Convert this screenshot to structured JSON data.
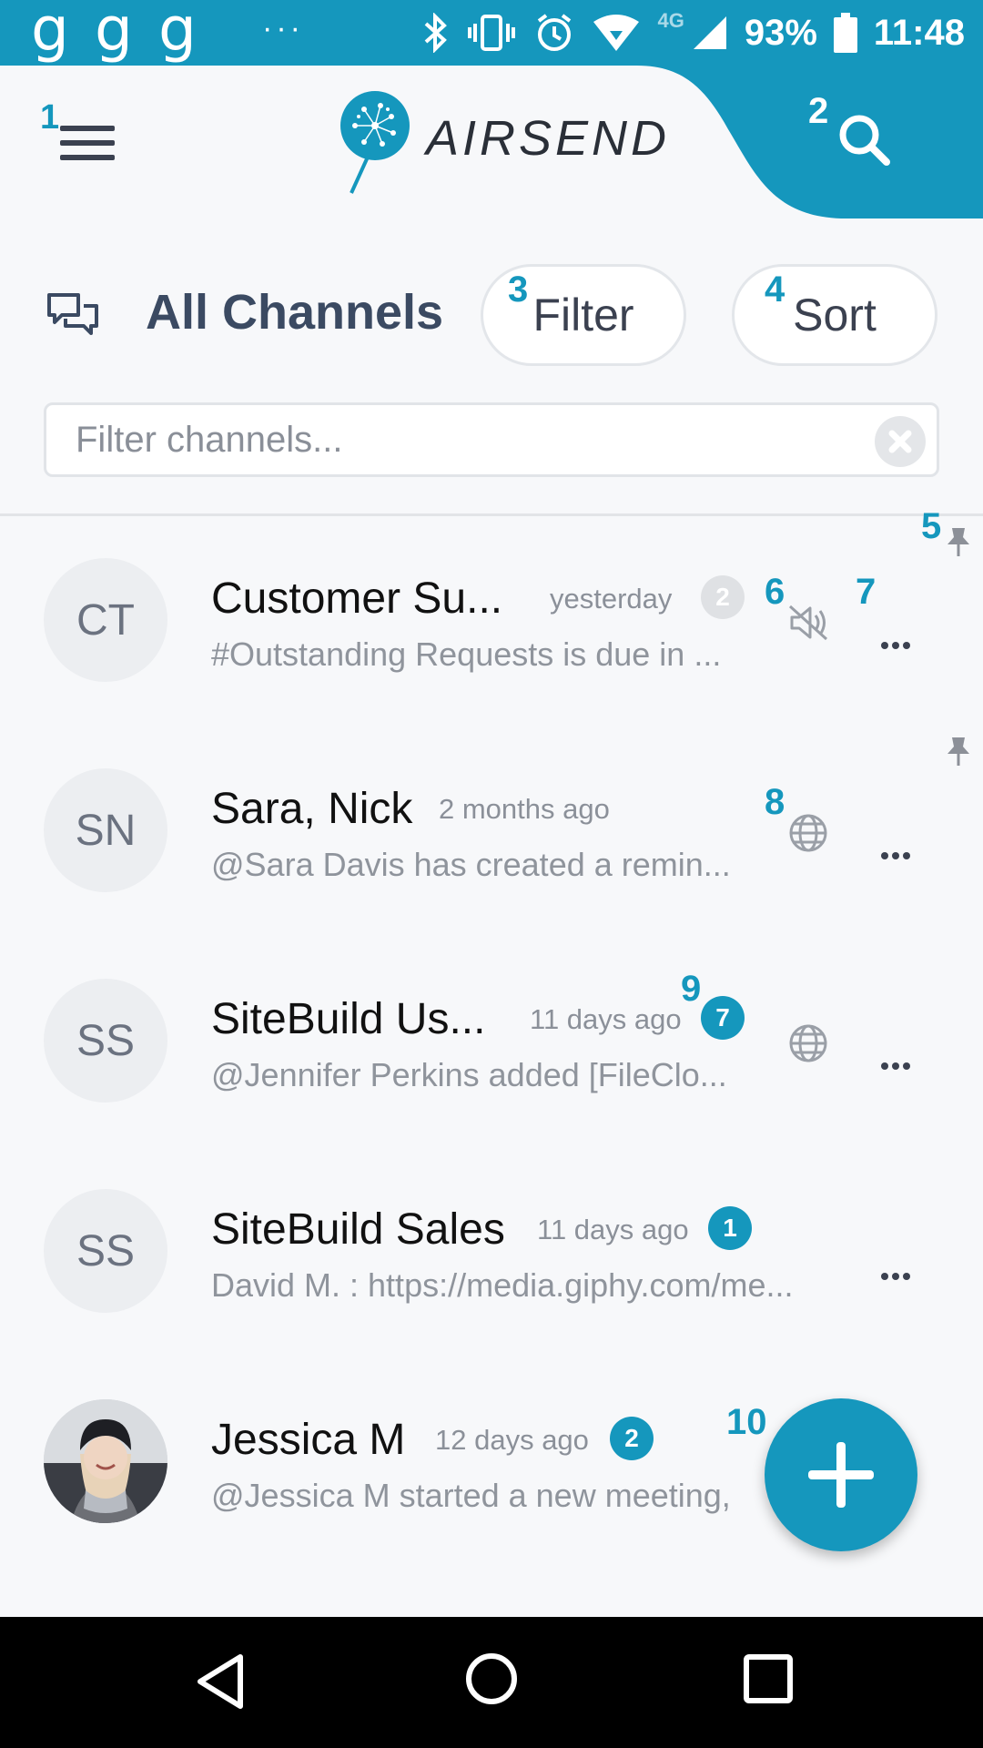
{
  "status_bar": {
    "left_glyphs": [
      "g",
      "g",
      "g"
    ],
    "overflow": "···",
    "network": "4G",
    "battery": "93%",
    "time": "11:48"
  },
  "header": {
    "app_name": "AIRSEND",
    "annotations": {
      "menu": "1",
      "search": "2"
    }
  },
  "toolbar": {
    "title": "All Channels",
    "filter_label": "Filter",
    "sort_label": "Sort",
    "filter_annot": "3",
    "sort_annot": "4",
    "search_placeholder": "Filter channels..."
  },
  "annotations": {
    "pin": "5",
    "mute": "6",
    "more": "7",
    "globe": "8",
    "unread": "9",
    "fab": "10"
  },
  "channels": [
    {
      "initials": "CT",
      "name": "Customer Su...",
      "time": "yesterday",
      "badge": "2",
      "badge_style": "grey",
      "message": "#Outstanding Requests is due in ...",
      "status_icon": "muted-icon",
      "pinned": true
    },
    {
      "initials": "SN",
      "name": "Sara, Nick",
      "time": "2 months ago",
      "badge": "",
      "message": "@Sara Davis has created a remin...",
      "status_icon": "globe-icon",
      "pinned": true
    },
    {
      "initials": "SS",
      "name": "SiteBuild Us...",
      "time": "11 days ago",
      "badge": "7",
      "badge_style": "teal",
      "message": "@Jennifer Perkins added [FileClo...",
      "status_icon": "globe-icon",
      "pinned": false
    },
    {
      "initials": "SS",
      "name": "SiteBuild Sales",
      "time": "11 days ago",
      "badge": "1",
      "badge_style": "teal",
      "message": "David M. : https://media.giphy.com/me...",
      "status_icon": "",
      "pinned": false
    },
    {
      "initials": "",
      "name": "Jessica M",
      "time": "12 days ago",
      "badge": "2",
      "badge_style": "teal",
      "message": "@Jessica M started a new meeting,",
      "status_icon": "",
      "pinned": false
    }
  ],
  "colors": {
    "accent": "#1597bd",
    "title": "#3b4a62",
    "background": "#f7f8fa"
  }
}
